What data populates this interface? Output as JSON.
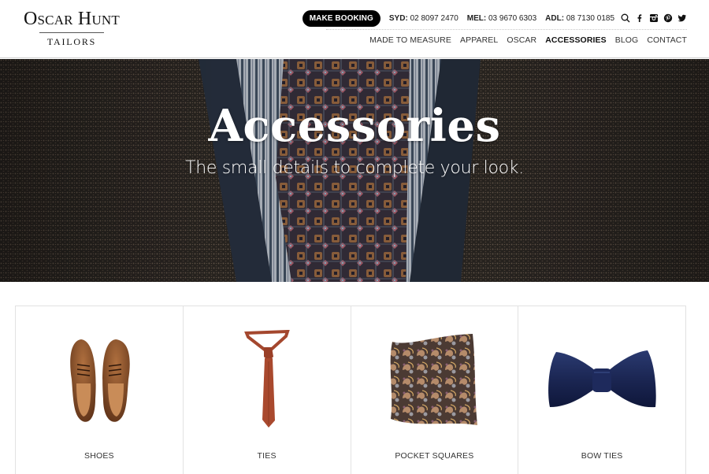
{
  "brand": {
    "name": "Oscar Hunt",
    "tagline": "TAILORS"
  },
  "topbar": {
    "booking_label": "MAKE BOOKING",
    "phones": [
      {
        "city": "SYD:",
        "number": "02 8097 2470"
      },
      {
        "city": "MEL:",
        "number": "03 9670 6303"
      },
      {
        "city": "ADL:",
        "number": "08 7130 0185"
      }
    ],
    "icons": [
      "search-icon",
      "facebook-icon",
      "instagram-icon",
      "pinterest-icon",
      "twitter-icon"
    ]
  },
  "nav": {
    "items": [
      {
        "label": "MADE TO MEASURE",
        "active": false
      },
      {
        "label": "APPAREL",
        "active": false
      },
      {
        "label": "OSCAR",
        "active": false
      },
      {
        "label": "ACCESSORIES",
        "active": true
      },
      {
        "label": "BLOG",
        "active": false
      },
      {
        "label": "CONTACT",
        "active": false
      }
    ]
  },
  "hero": {
    "title": "Accessories",
    "subtitle": "The small details to complete your look."
  },
  "categories": [
    {
      "label": "SHOES",
      "image": "brown-brogue-shoes"
    },
    {
      "label": "TIES",
      "image": "rust-silk-tie"
    },
    {
      "label": "POCKET SQUARES",
      "image": "paisley-pocket-square"
    },
    {
      "label": "BOW TIES",
      "image": "navy-bow-tie"
    }
  ],
  "colors": {
    "accent": "#000000",
    "text": "#222222",
    "hero_overlay": "#2b2622"
  }
}
